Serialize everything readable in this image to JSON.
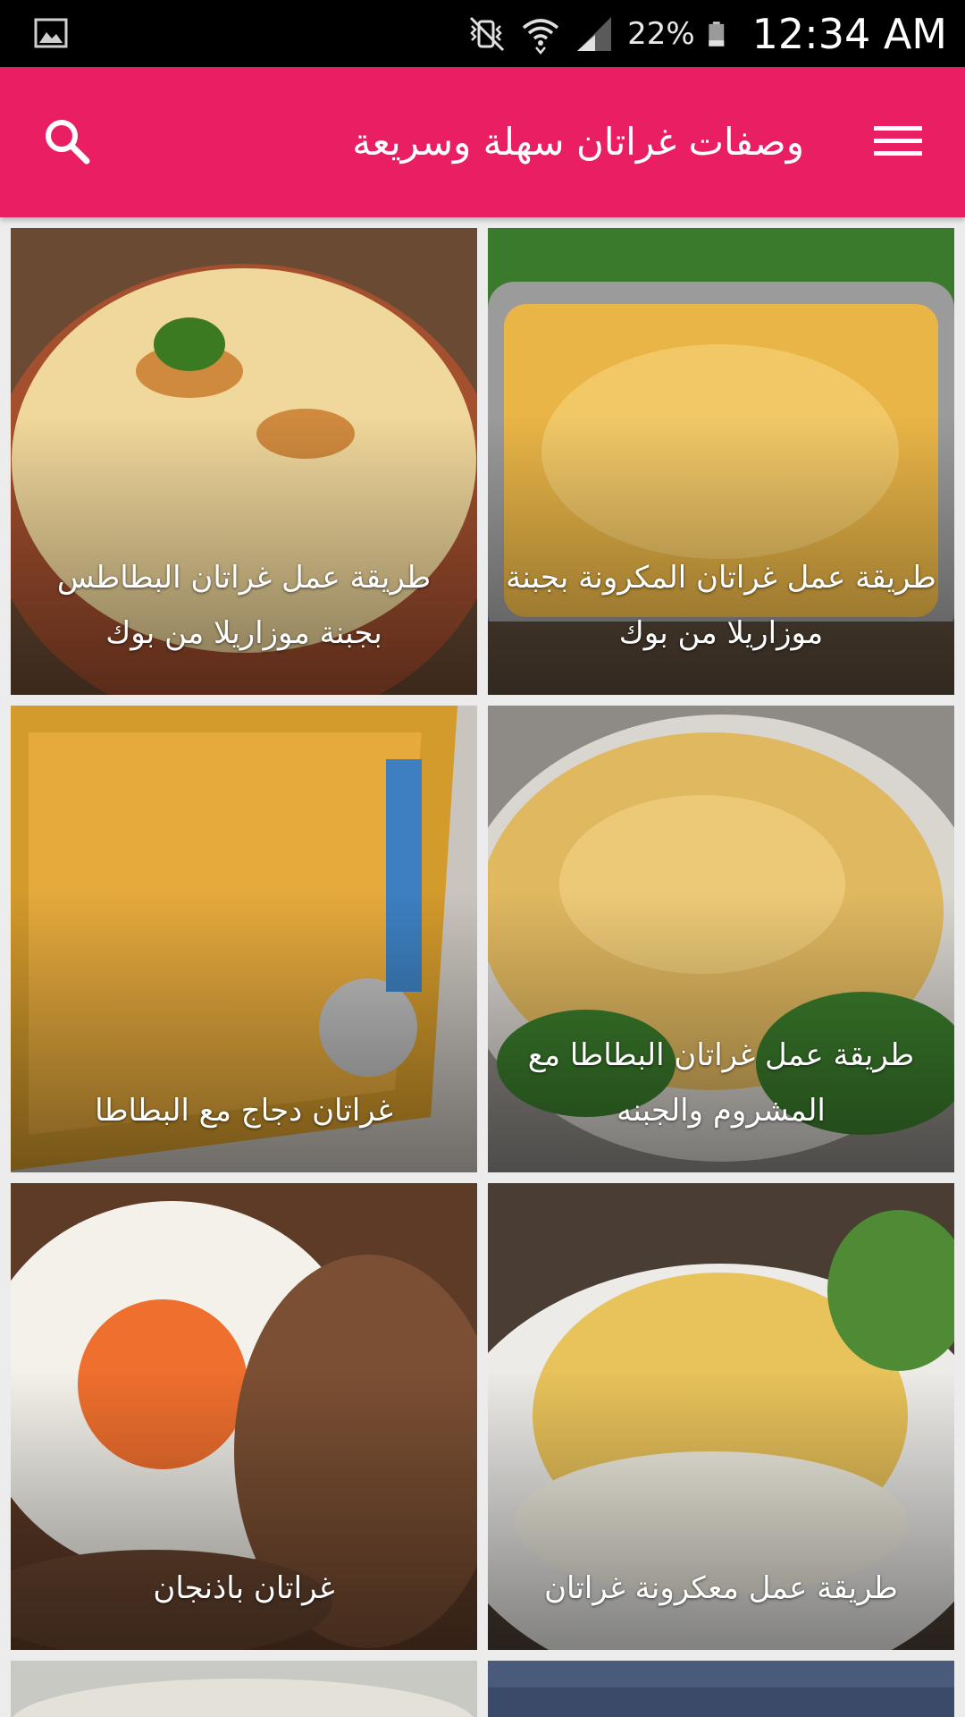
{
  "status_bar": {
    "left_icon": "gallery-image-icon",
    "icons": [
      "mute-vibrate-icon",
      "wifi-icon",
      "signal-icon",
      "battery-icon"
    ],
    "battery_percent": "22%",
    "time": "12:34 AM"
  },
  "app_bar": {
    "title": "وصفات غراتان سهلة وسريعة",
    "search_icon": "search-icon",
    "menu_icon": "menu-icon",
    "color": "#e91e63"
  },
  "recipes": [
    {
      "title": "طريقة عمل غراتان المكرونة بجبنة موزاريلا من بوك",
      "photo_color": "#e7b64a"
    },
    {
      "title": "طريقة عمل غراتان البطاطس بجبنة موزاريلا من بوك",
      "photo_color": "#d89a55"
    },
    {
      "title": "طريقة عمل غراتان البطاطا مع المشروم والجبنه",
      "photo_color": "#d7a65a"
    },
    {
      "title": "غراتان دجاج مع البطاطا",
      "photo_color": "#d4a038"
    },
    {
      "title": "طريقة عمل معكرونة غراتان",
      "photo_color": "#e6d2a3"
    },
    {
      "title": "غراتان باذنجان",
      "photo_color": "#7a4f36"
    }
  ]
}
